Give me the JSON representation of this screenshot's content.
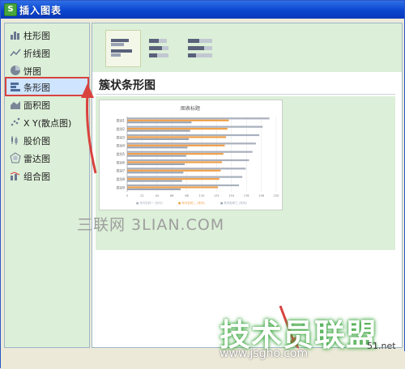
{
  "window": {
    "title": "插入图表",
    "icon_letter": "S"
  },
  "sidebar": {
    "items": [
      {
        "label": "柱形图",
        "icon": "column-chart-icon"
      },
      {
        "label": "折线图",
        "icon": "line-chart-icon"
      },
      {
        "label": "饼图",
        "icon": "pie-chart-icon"
      },
      {
        "label": "条形图",
        "icon": "bar-chart-icon",
        "selected": true
      },
      {
        "label": "面积图",
        "icon": "area-chart-icon"
      },
      {
        "label": "X Y(散点图)",
        "icon": "scatter-chart-icon"
      },
      {
        "label": "股价图",
        "icon": "stock-chart-icon"
      },
      {
        "label": "雷达图",
        "icon": "radar-chart-icon"
      },
      {
        "label": "组合图",
        "icon": "combo-chart-icon"
      }
    ]
  },
  "content": {
    "section_title": "簇状条形图",
    "preview_title": "图表标题",
    "legend": [
      "■ 系列名称一 (系列)",
      "■ 系列名称二 (系列)",
      "■ 系列名称三 (系列)"
    ],
    "colors": {
      "series1": "#a9b0bd",
      "series2": "#f0a04b",
      "series3": "#9aa4b4"
    }
  },
  "watermarks": {
    "left_text": "三联网 3LIAN.COM",
    "brand": "技术员联盟",
    "url": "www.jsgho.com",
    "corner": "51.net"
  },
  "chart_data": {
    "type": "bar",
    "orientation": "horizontal",
    "title": "图表标题",
    "categories": [
      "类别1",
      "类别2",
      "类别3",
      "类别4",
      "类别5",
      "类别6",
      "类别7",
      "类别8",
      "类别9"
    ],
    "series": [
      {
        "name": "系列名称一",
        "values": [
          210,
          200,
          195,
          190,
          185,
          180,
          175,
          170,
          165
        ]
      },
      {
        "name": "系列名称二",
        "values": [
          150,
          148,
          146,
          144,
          142,
          140,
          138,
          136,
          134
        ]
      },
      {
        "name": "系列名称三",
        "values": [
          95,
          93,
          91,
          89,
          87,
          85,
          83,
          81,
          79
        ]
      }
    ],
    "xlim": [
      0,
      220
    ],
    "grid": true,
    "legend_position": "bottom"
  }
}
